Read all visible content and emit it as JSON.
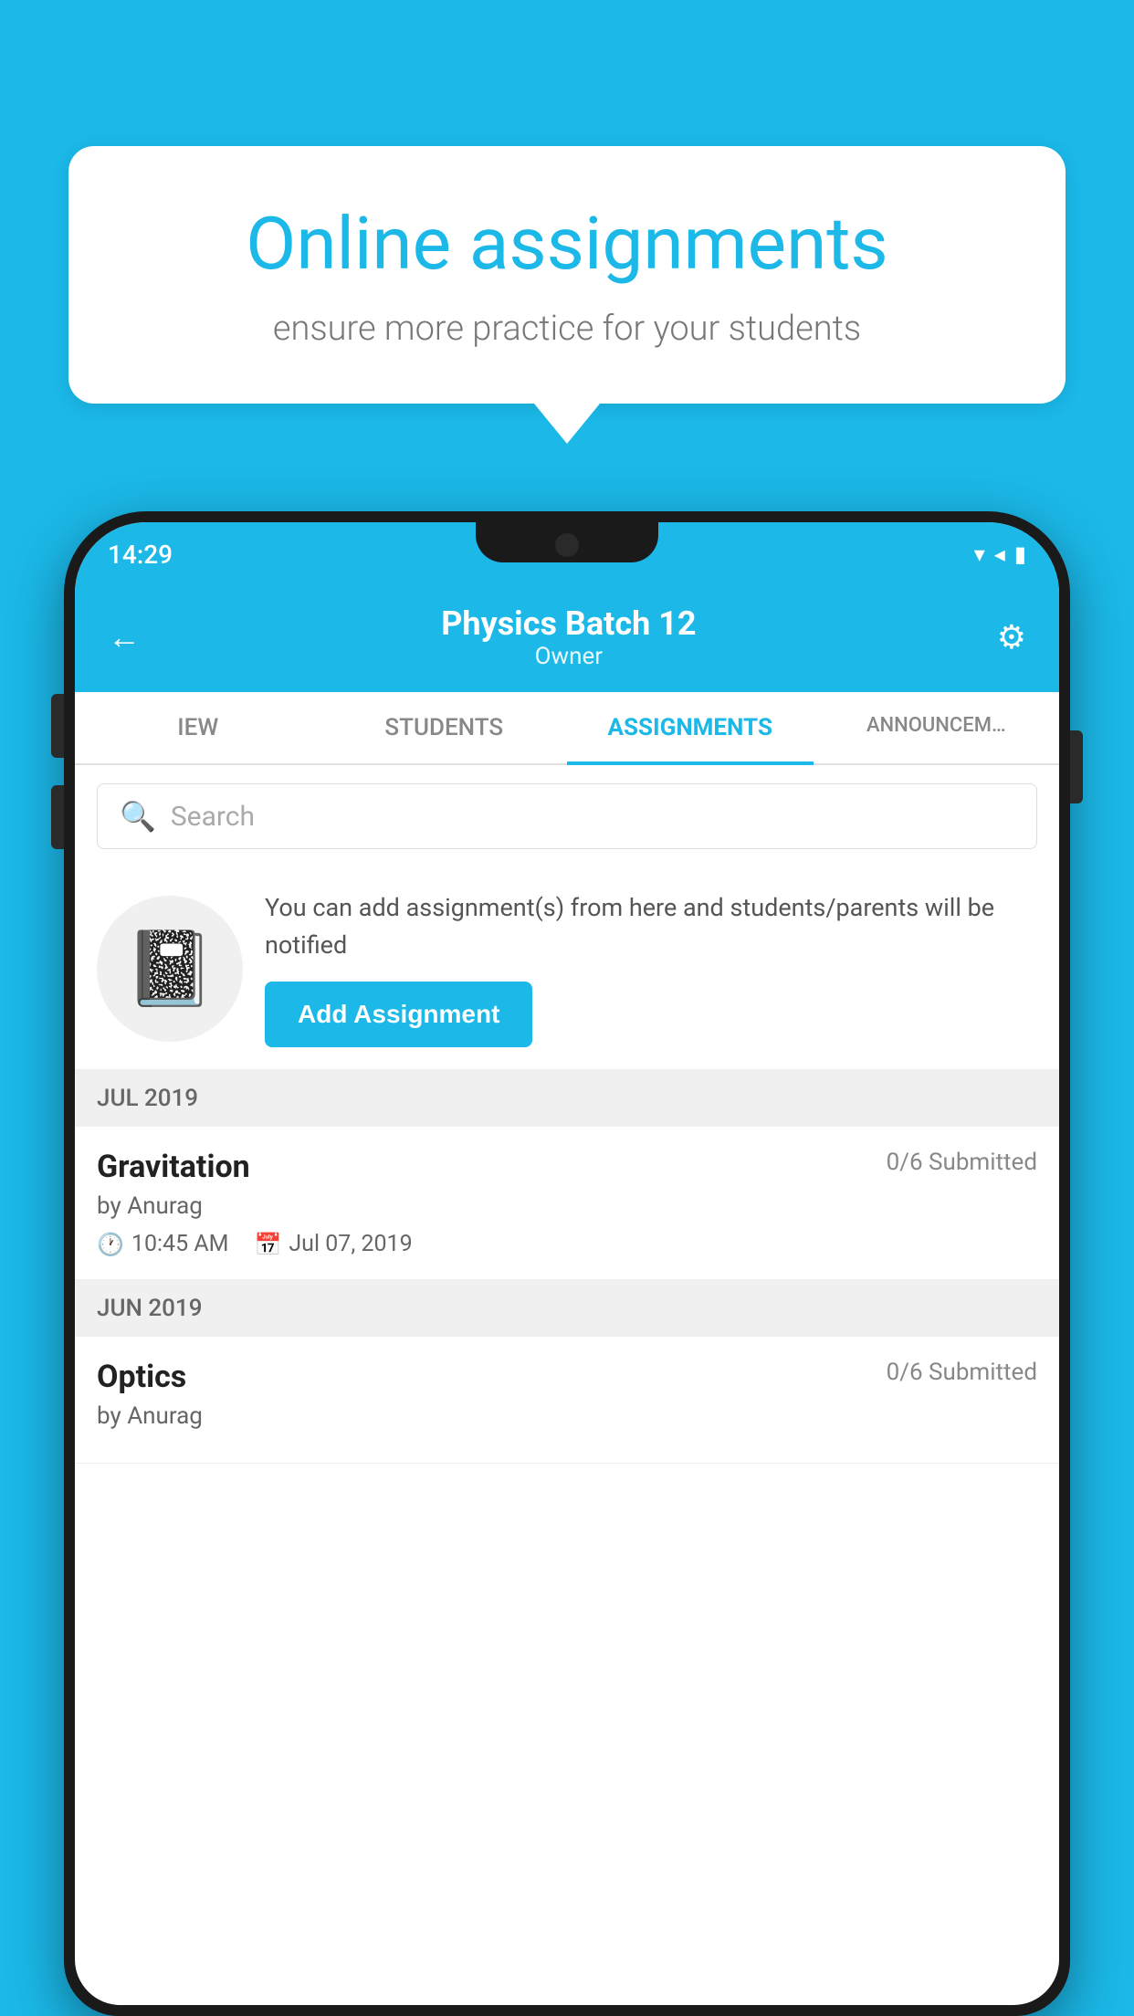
{
  "background_color": "#1BB8E8",
  "bubble": {
    "title": "Online assignments",
    "subtitle": "ensure more practice for your students"
  },
  "phone": {
    "status_bar": {
      "time": "14:29",
      "icons": [
        "wifi",
        "signal",
        "battery"
      ]
    },
    "header": {
      "title": "Physics Batch 12",
      "subtitle": "Owner",
      "back_label": "←",
      "settings_label": "⚙"
    },
    "tabs": [
      {
        "label": "IEW",
        "active": false
      },
      {
        "label": "STUDENTS",
        "active": false
      },
      {
        "label": "ASSIGNMENTS",
        "active": true
      },
      {
        "label": "ANNOUNCEM…",
        "active": false
      }
    ],
    "search": {
      "placeholder": "Search"
    },
    "promo": {
      "description": "You can add assignment(s) from here and students/parents will be notified",
      "button_label": "Add Assignment"
    },
    "sections": [
      {
        "label": "JUL 2019",
        "assignments": [
          {
            "name": "Gravitation",
            "submitted": "0/6 Submitted",
            "author": "by Anurag",
            "time": "10:45 AM",
            "date": "Jul 07, 2019"
          }
        ]
      },
      {
        "label": "JUN 2019",
        "assignments": [
          {
            "name": "Optics",
            "submitted": "0/6 Submitted",
            "author": "by Anurag",
            "time": "",
            "date": ""
          }
        ]
      }
    ]
  }
}
